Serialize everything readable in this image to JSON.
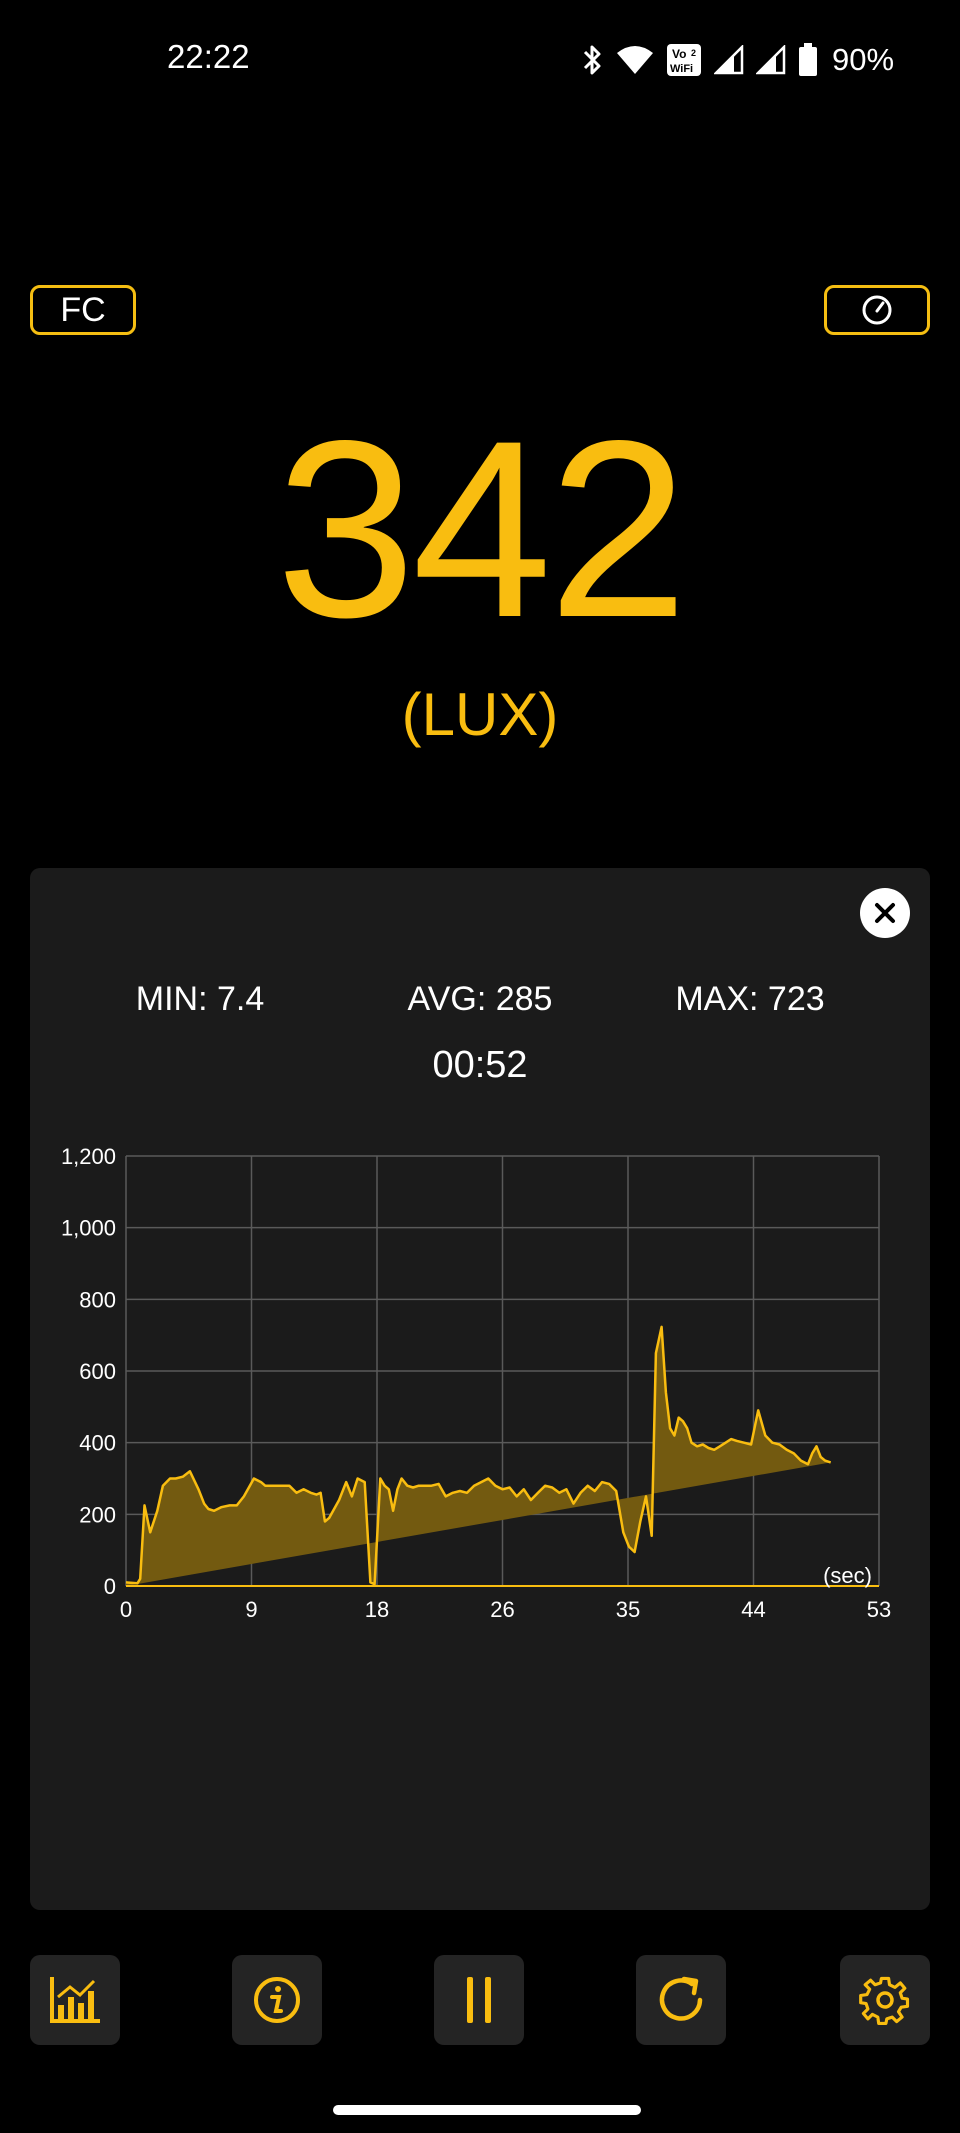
{
  "status_bar": {
    "time": "22:22",
    "battery_percent": "90%",
    "icons": [
      "bluetooth-icon",
      "wifi-icon",
      "vowifi-icon",
      "signal-icon",
      "signal-icon",
      "battery-icon"
    ],
    "vowifi_top": "Vo",
    "vowifi_sub": "2",
    "vowifi_bottom": "WiFi"
  },
  "header": {
    "unit_toggle_label": "FC",
    "gauge_button_icon": "gauge-icon"
  },
  "reading": {
    "value": "342",
    "unit": "(LUX)"
  },
  "stats": {
    "min": "MIN: 7.4",
    "avg": "AVG: 285",
    "max": "MAX: 723",
    "elapsed": "00:52"
  },
  "colors": {
    "accent": "#F9BD10",
    "fill": "#735A10",
    "panel": "#1b1b1b"
  },
  "chart_data": {
    "type": "area",
    "xlabel": "(sec)",
    "ylabel": "",
    "xlim": [
      0,
      53
    ],
    "ylim": [
      0,
      1200
    ],
    "x_ticks": [
      "0",
      "9",
      "18",
      "26",
      "35",
      "44",
      "53"
    ],
    "y_ticks": [
      "0",
      "200",
      "400",
      "600",
      "800",
      "1,000",
      "1,200"
    ],
    "grid": true,
    "x": [
      0,
      0.8,
      1.0,
      1.3,
      1.7,
      2.2,
      2.6,
      3.1,
      3.5,
      4.0,
      4.5,
      5.1,
      5.5,
      5.8,
      6.2,
      6.7,
      7.3,
      7.8,
      8.3,
      9.0,
      9.5,
      9.8,
      10.2,
      10.6,
      11.0,
      11.5,
      12.0,
      12.5,
      13.0,
      13.4,
      13.7,
      14.0,
      14.3,
      15.0,
      15.5,
      15.9,
      16.3,
      16.8,
      17.2,
      17.5,
      17.9,
      18.2,
      18.5,
      18.8,
      19.1,
      19.4,
      19.8,
      20.2,
      20.6,
      21.0,
      21.5,
      22.0,
      22.5,
      23.0,
      23.5,
      24.0,
      24.5,
      25.0,
      25.5,
      26.0,
      26.5,
      27.0,
      27.5,
      28.0,
      28.5,
      29.0,
      29.5,
      30.0,
      30.5,
      31.0,
      31.5,
      32.0,
      32.5,
      33.0,
      33.5,
      34.0,
      34.5,
      35.0,
      35.4,
      35.8,
      36.2,
      36.6,
      37.0,
      37.3,
      37.7,
      38.0,
      38.3,
      38.6,
      38.9,
      39.2,
      39.5,
      39.8,
      40.2,
      40.6,
      41.0,
      41.4,
      41.8,
      42.2,
      42.6,
      43.0,
      43.5,
      44.0,
      44.5,
      45.0,
      45.5,
      46.0,
      46.5,
      47.0,
      47.5,
      48.0,
      48.3,
      48.6,
      48.9,
      49.2,
      49.6,
      50.0,
      50.4,
      50.8,
      51.2,
      51.6,
      52.0,
      52.4,
      53.0
    ],
    "series": [
      {
        "values": [
          10,
          7.4,
          20,
          225,
          150,
          210,
          280,
          300,
          300,
          305,
          320,
          270,
          230,
          215,
          210,
          220,
          225,
          225,
          250,
          300,
          290,
          280,
          280,
          280,
          280,
          280,
          260,
          270,
          260,
          255,
          260,
          180,
          190,
          240,
          290,
          250,
          300,
          290,
          10,
          5,
          300,
          280,
          270,
          210,
          270,
          300,
          280,
          275,
          280,
          280,
          280,
          285,
          250,
          260,
          265,
          260,
          280,
          290,
          300,
          280,
          270,
          275,
          250,
          270,
          240,
          260,
          280,
          275,
          260,
          270,
          230,
          260,
          280,
          265,
          290,
          285,
          265,
          150,
          110,
          95,
          180,
          250,
          140,
          650,
          723,
          540,
          440,
          420,
          470,
          460,
          440,
          400,
          390,
          395,
          385,
          380,
          390,
          400,
          410,
          405,
          400,
          395,
          490,
          420,
          400,
          395,
          380,
          370,
          350,
          340,
          370,
          390,
          360,
          350,
          345
        ],
        "color": "#F9BD10"
      }
    ]
  },
  "bottom_bar": {
    "buttons": [
      "chart-icon",
      "info-icon",
      "pause-icon",
      "refresh-icon",
      "gear-icon"
    ]
  }
}
